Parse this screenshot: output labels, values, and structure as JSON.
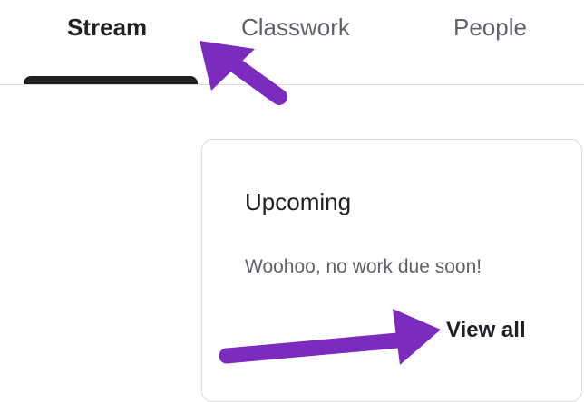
{
  "tabs": {
    "stream": "Stream",
    "classwork": "Classwork",
    "people": "People"
  },
  "upcoming": {
    "title": "Upcoming",
    "message": "Woohoo, no work due soon!",
    "view_all": "View all"
  },
  "colors": {
    "annotation_arrow": "#7b2cbf",
    "active_indicator": "#1f1f1f",
    "divider": "#dadce0"
  }
}
